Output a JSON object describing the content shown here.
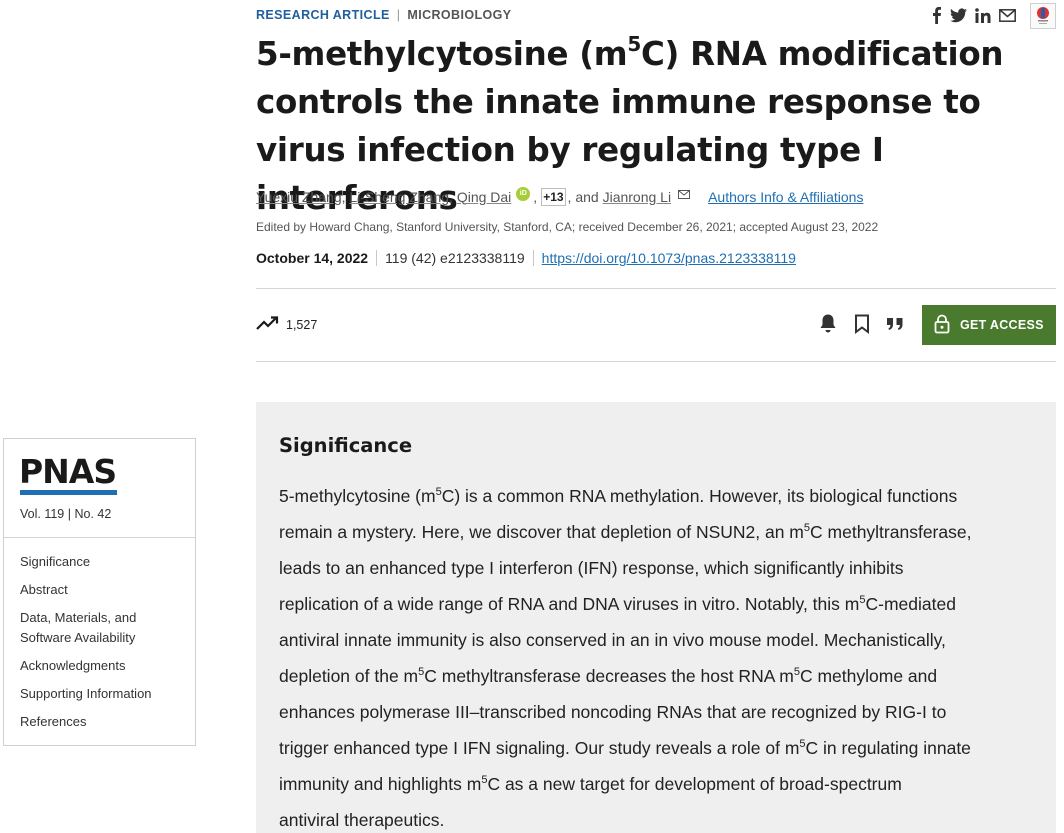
{
  "header": {
    "article_type": "RESEARCH ARTICLE",
    "separator": "|",
    "subject": "MICROBIOLOGY",
    "share_icons": [
      "facebook-icon",
      "twitter-icon",
      "linkedin-icon",
      "email-icon"
    ],
    "crossmark_label": "Check for updates"
  },
  "title": {
    "part1": "5-methylcytosine (m",
    "sup": "5",
    "part2": "C) RNA modification controls the innate immune response to virus infection by regulating type I interferons"
  },
  "authors": {
    "list": [
      "Yuexiu Zhang",
      "Li-Sheng Zhang",
      "Qing Dai"
    ],
    "sep1": ",",
    "sep2": ",",
    "sep3": ",",
    "orcid_label": "iD",
    "more_count": "+13",
    "and_text": ", and",
    "last": "Jianrong Li",
    "affiliations_link": "Authors Info & Affiliations"
  },
  "edited_line": "Edited by Howard Chang, Stanford University, Stanford, CA; received December 26, 2021; accepted August 23, 2022",
  "publication": {
    "date": "October 14, 2022",
    "citation": "119 (42) e2123338119",
    "doi": "https://doi.org/10.1073/pnas.2123338119"
  },
  "metrics": {
    "views": "1,527"
  },
  "access_button": "GET ACCESS",
  "sidebar": {
    "logo": "PNAS",
    "volume": "Vol. 119 | No. 42",
    "items": [
      "Significance",
      "Abstract",
      "Data, Materials, and",
      "Software Availability",
      "Acknowledgments",
      "Supporting Information",
      "References"
    ]
  },
  "significance": {
    "heading": "Significance",
    "lines": [
      [
        "5-methylcytosine (m",
        "5",
        "C) is a common RNA methylation. However, its biological functions"
      ],
      [
        "remain a mystery. Here, we discover that depletion of NSUN2, an m",
        "5",
        "C methyltransferase,"
      ],
      [
        "leads to an enhanced type I interferon (IFN) response, which significantly inhibits"
      ],
      [
        "replication of a wide range of RNA and DNA viruses in vitro. Notably, this m",
        "5",
        "C-mediated"
      ],
      [
        "antiviral innate immunity is also conserved in an in vivo mouse model. Mechanistically,"
      ],
      [
        "depletion of the m",
        "5",
        "C methyltransferase decreases the host RNA m",
        "5",
        "C methylome and"
      ],
      [
        "enhances polymerase III–transcribed noncoding RNAs that are recognized by RIG-I to"
      ],
      [
        "trigger enhanced type I IFN signaling. Our study reveals a role of m",
        "5",
        "C in regulating innate"
      ],
      [
        "immunity and highlights m",
        "5",
        "C as a new target for development of broad-spectrum"
      ],
      [
        "antiviral therapeutics."
      ]
    ]
  }
}
